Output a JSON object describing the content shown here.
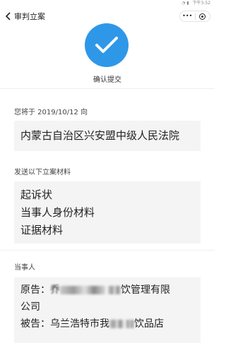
{
  "status_bar": {
    "time": "下午3:52"
  },
  "nav": {
    "title": "审判立案"
  },
  "confirm": {
    "label": "确认提交"
  },
  "court_section": {
    "label": "您将于 2019/10/12 向",
    "court": "内蒙古自治区兴安盟中级人民法院"
  },
  "materials_section": {
    "label": "发送以下立案材料",
    "items": [
      "起诉状",
      "当事人身份材料",
      "证据材料"
    ]
  },
  "parties_section": {
    "label": "当事人",
    "plaintiff_prefix": "原告：",
    "plaintiff_visible_start": "乔",
    "plaintiff_visible_end": "饮管理有限",
    "plaintiff_line2": "公司",
    "defendant_prefix": "被告：",
    "defendant_visible_start": "乌兰浩特市我",
    "defendant_visible_end": "饮品店"
  },
  "colors": {
    "accent": "#2f97e8",
    "box_bg": "#f4f4f4"
  }
}
